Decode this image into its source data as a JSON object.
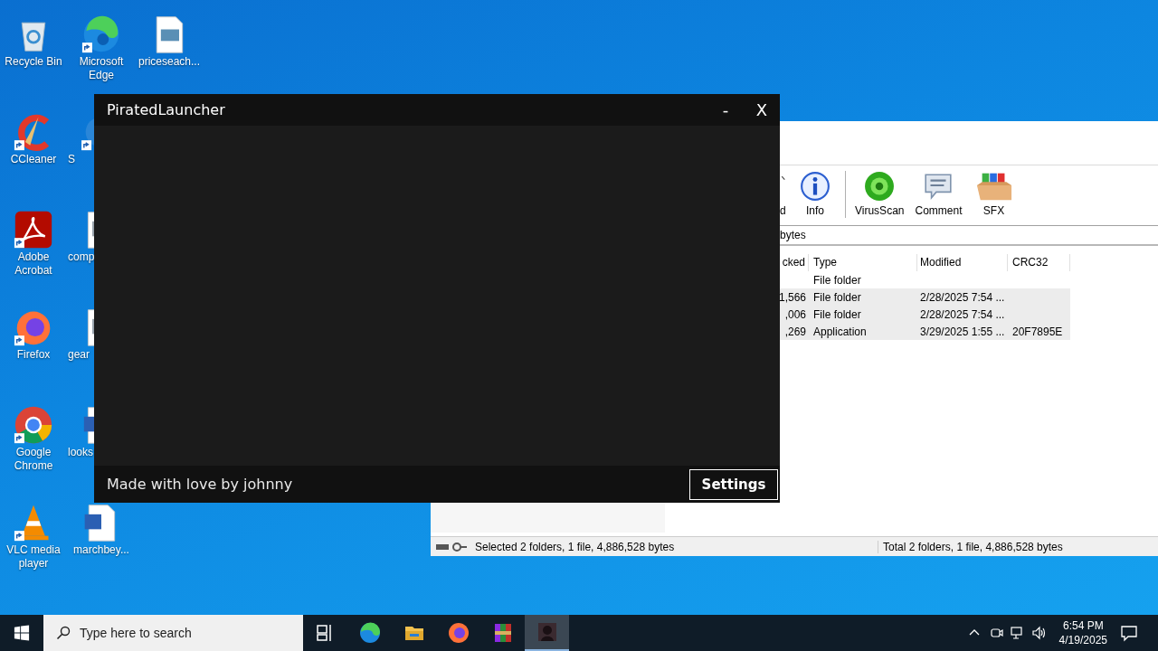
{
  "desktop": {
    "icons": [
      {
        "label": "Recycle Bin",
        "kind": "recycle",
        "shortcut": false,
        "cut": false
      },
      {
        "label": "CCleaner",
        "kind": "ccleaner",
        "shortcut": true,
        "cut": false
      },
      {
        "label": "Adobe Acrobat",
        "kind": "acrobat",
        "shortcut": true,
        "cut": false
      },
      {
        "label": "Firefox",
        "kind": "firefox",
        "shortcut": true,
        "cut": false
      },
      {
        "label": "Google Chrome",
        "kind": "chrome",
        "shortcut": true,
        "cut": false
      },
      {
        "label": "VLC media player",
        "kind": "vlc",
        "shortcut": true,
        "cut": false
      },
      {
        "label": "Microsoft Edge",
        "kind": "edge",
        "shortcut": true,
        "cut": false
      },
      {
        "label": "S",
        "kind": "app",
        "shortcut": true,
        "cut": true
      },
      {
        "label": "comp",
        "kind": "file",
        "shortcut": false,
        "cut": true
      },
      {
        "label": "gear",
        "kind": "file",
        "shortcut": false,
        "cut": true
      },
      {
        "label": "looks",
        "kind": "word",
        "shortcut": false,
        "cut": true
      },
      {
        "label": "marchbey...",
        "kind": "word",
        "shortcut": false,
        "cut": false
      },
      {
        "label": "priceseach...",
        "kind": "image",
        "shortcut": false,
        "cut": false
      }
    ]
  },
  "archiver": {
    "toolbar": [
      {
        "label": "d",
        "kind": "find"
      },
      {
        "label": "Info",
        "kind": "info"
      },
      {
        "label": "VirusScan",
        "kind": "virus"
      },
      {
        "label": "Comment",
        "kind": "comment"
      },
      {
        "label": "SFX",
        "kind": "sfx"
      }
    ],
    "address": "bytes",
    "columns": [
      "cked",
      "Type",
      "Modified",
      "CRC32"
    ],
    "rows": [
      {
        "type": "File folder",
        "selected": false
      },
      {
        "packed": "1,566",
        "type": "File folder",
        "modified": "2/28/2025 7:54 ...",
        "selected": true
      },
      {
        "packed": ",006",
        "type": "File folder",
        "modified": "2/28/2025 7:54 ...",
        "selected": true
      },
      {
        "packed": ",269",
        "type": "Application",
        "modified": "3/29/2025 1:55 ...",
        "crc": "20F7895E",
        "selected": true
      }
    ],
    "status_left": "Selected 2 folders, 1 file, 4,886,528 bytes",
    "status_right": "Total 2 folders, 1 file, 4,886,528 bytes"
  },
  "launcher": {
    "title": "PiratedLauncher",
    "minimize": "-",
    "close": "X",
    "footer": "Made with love by johnny",
    "settings_button": "Settings"
  },
  "taskbar": {
    "search_placeholder": "Type here to search",
    "apps": [
      {
        "kind": "taskview",
        "selected": false
      },
      {
        "kind": "edge",
        "selected": false
      },
      {
        "kind": "explorer",
        "selected": false
      },
      {
        "kind": "firefox",
        "selected": false
      },
      {
        "kind": "winrar",
        "selected": false
      },
      {
        "kind": "launcher",
        "selected": true
      }
    ],
    "time": "6:54 PM",
    "date": "4/19/2025"
  }
}
